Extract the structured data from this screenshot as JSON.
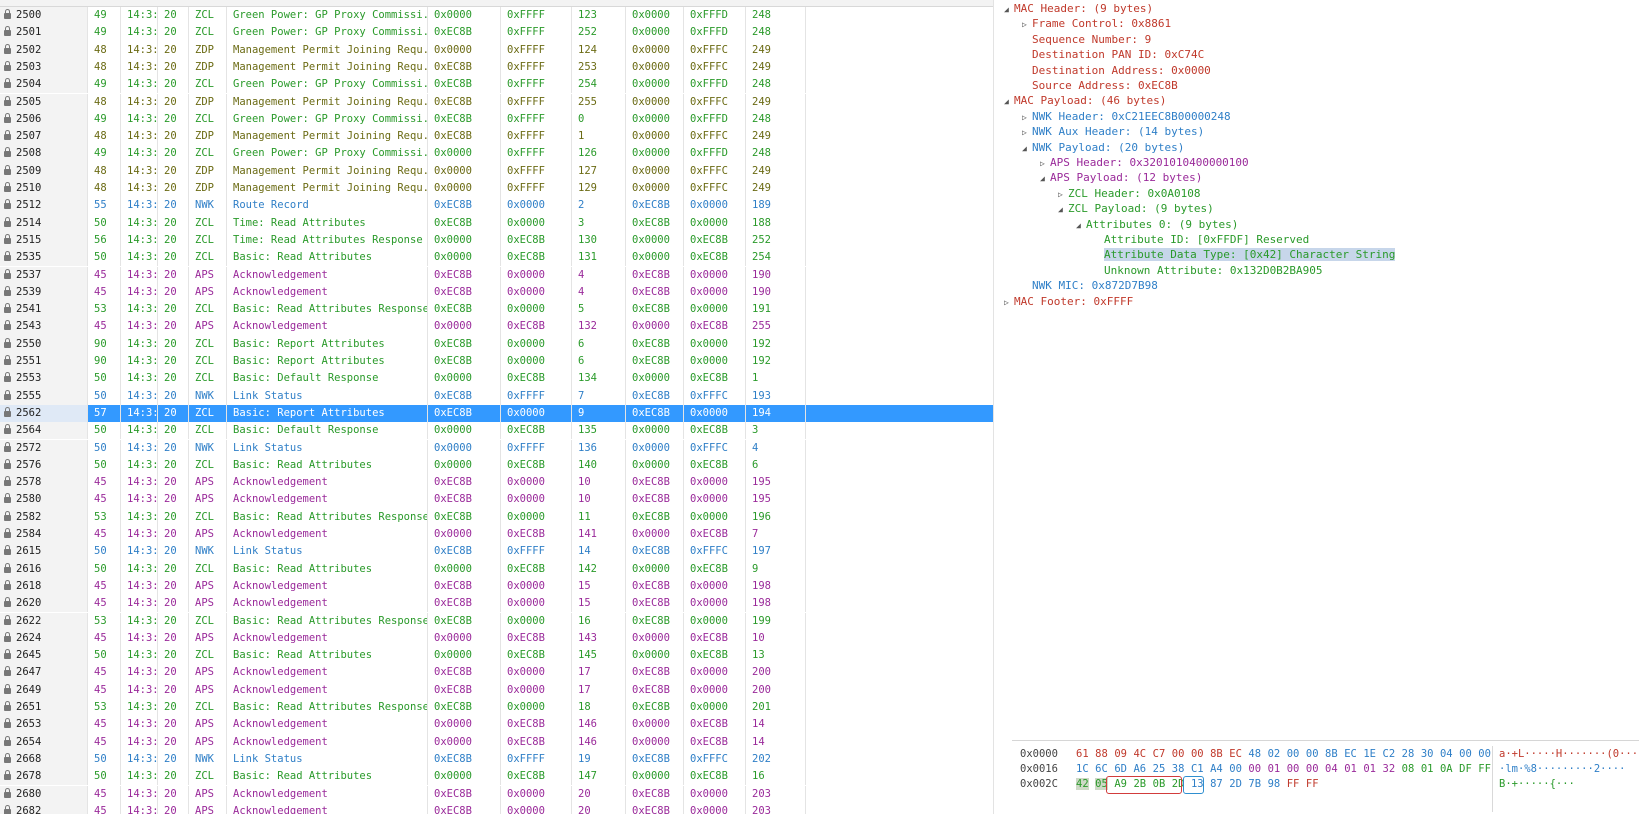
{
  "packet_list": {
    "rows": [
      [
        "2500",
        "49",
        "14:3:",
        "20",
        "ZCL",
        "Green Power: GP Proxy Commissi...",
        "0x0000",
        "0xFFFF",
        "123",
        "0x0000",
        "0xFFFD",
        "248"
      ],
      [
        "2501",
        "49",
        "14:3:",
        "20",
        "ZCL",
        "Green Power: GP Proxy Commissi...",
        "0xEC8B",
        "0xFFFF",
        "252",
        "0x0000",
        "0xFFFD",
        "248"
      ],
      [
        "2502",
        "48",
        "14:3:",
        "20",
        "ZDP",
        "Management Permit Joining Requ...",
        "0x0000",
        "0xFFFF",
        "124",
        "0x0000",
        "0xFFFC",
        "249"
      ],
      [
        "2503",
        "48",
        "14:3:",
        "20",
        "ZDP",
        "Management Permit Joining Requ...",
        "0xEC8B",
        "0xFFFF",
        "253",
        "0x0000",
        "0xFFFC",
        "249"
      ],
      [
        "2504",
        "49",
        "14:3:",
        "20",
        "ZCL",
        "Green Power: GP Proxy Commissi...",
        "0xEC8B",
        "0xFFFF",
        "254",
        "0x0000",
        "0xFFFD",
        "248"
      ],
      [
        "2505",
        "48",
        "14:3:",
        "20",
        "ZDP",
        "Management Permit Joining Requ...",
        "0xEC8B",
        "0xFFFF",
        "255",
        "0x0000",
        "0xFFFC",
        "249"
      ],
      [
        "2506",
        "49",
        "14:3:",
        "20",
        "ZCL",
        "Green Power: GP Proxy Commissi...",
        "0xEC8B",
        "0xFFFF",
        "0",
        "0x0000",
        "0xFFFD",
        "248"
      ],
      [
        "2507",
        "48",
        "14:3:",
        "20",
        "ZDP",
        "Management Permit Joining Requ...",
        "0xEC8B",
        "0xFFFF",
        "1",
        "0x0000",
        "0xFFFC",
        "249"
      ],
      [
        "2508",
        "49",
        "14:3:",
        "20",
        "ZCL",
        "Green Power: GP Proxy Commissi...",
        "0x0000",
        "0xFFFF",
        "126",
        "0x0000",
        "0xFFFD",
        "248"
      ],
      [
        "2509",
        "48",
        "14:3:",
        "20",
        "ZDP",
        "Management Permit Joining Requ...",
        "0x0000",
        "0xFFFF",
        "127",
        "0x0000",
        "0xFFFC",
        "249"
      ],
      [
        "2510",
        "48",
        "14:3:",
        "20",
        "ZDP",
        "Management Permit Joining Requ...",
        "0x0000",
        "0xFFFF",
        "129",
        "0x0000",
        "0xFFFC",
        "249"
      ],
      [
        "2512",
        "55",
        "14:3:",
        "20",
        "NWK",
        "Route Record",
        "0xEC8B",
        "0x0000",
        "2",
        "0xEC8B",
        "0x0000",
        "189"
      ],
      [
        "2514",
        "50",
        "14:3:",
        "20",
        "ZCL",
        "Time: Read Attributes",
        "0xEC8B",
        "0x0000",
        "3",
        "0xEC8B",
        "0x0000",
        "188"
      ],
      [
        "2515",
        "56",
        "14:3:",
        "20",
        "ZCL",
        "Time: Read Attributes Response",
        "0x0000",
        "0xEC8B",
        "130",
        "0x0000",
        "0xEC8B",
        "252"
      ],
      [
        "2535",
        "50",
        "14:3:",
        "20",
        "ZCL",
        "Basic: Read Attributes",
        "0x0000",
        "0xEC8B",
        "131",
        "0x0000",
        "0xEC8B",
        "254"
      ],
      [
        "2537",
        "45",
        "14:3:",
        "20",
        "APS",
        "Acknowledgement",
        "0xEC8B",
        "0x0000",
        "4",
        "0xEC8B",
        "0x0000",
        "190"
      ],
      [
        "2539",
        "45",
        "14:3:",
        "20",
        "APS",
        "Acknowledgement",
        "0xEC8B",
        "0x0000",
        "4",
        "0xEC8B",
        "0x0000",
        "190"
      ],
      [
        "2541",
        "53",
        "14:3:",
        "20",
        "ZCL",
        "Basic: Read Attributes Response",
        "0xEC8B",
        "0x0000",
        "5",
        "0xEC8B",
        "0x0000",
        "191"
      ],
      [
        "2543",
        "45",
        "14:3:",
        "20",
        "APS",
        "Acknowledgement",
        "0x0000",
        "0xEC8B",
        "132",
        "0x0000",
        "0xEC8B",
        "255"
      ],
      [
        "2550",
        "90",
        "14:3:",
        "20",
        "ZCL",
        "Basic: Report Attributes",
        "0xEC8B",
        "0x0000",
        "6",
        "0xEC8B",
        "0x0000",
        "192"
      ],
      [
        "2551",
        "90",
        "14:3:",
        "20",
        "ZCL",
        "Basic: Report Attributes",
        "0xEC8B",
        "0x0000",
        "6",
        "0xEC8B",
        "0x0000",
        "192"
      ],
      [
        "2553",
        "50",
        "14:3:",
        "20",
        "ZCL",
        "Basic: Default Response",
        "0x0000",
        "0xEC8B",
        "134",
        "0x0000",
        "0xEC8B",
        "1"
      ],
      [
        "2555",
        "50",
        "14:3:",
        "20",
        "NWK",
        "Link Status",
        "0xEC8B",
        "0xFFFF",
        "7",
        "0xEC8B",
        "0xFFFC",
        "193"
      ],
      [
        "2562",
        "57",
        "14:3:",
        "20",
        "ZCL",
        "Basic: Report Attributes",
        "0xEC8B",
        "0x0000",
        "9",
        "0xEC8B",
        "0x0000",
        "194"
      ],
      [
        "2564",
        "50",
        "14:3:",
        "20",
        "ZCL",
        "Basic: Default Response",
        "0x0000",
        "0xEC8B",
        "135",
        "0x0000",
        "0xEC8B",
        "3"
      ],
      [
        "2572",
        "50",
        "14:3:",
        "20",
        "NWK",
        "Link Status",
        "0x0000",
        "0xFFFF",
        "136",
        "0x0000",
        "0xFFFC",
        "4"
      ],
      [
        "2576",
        "50",
        "14:3:",
        "20",
        "ZCL",
        "Basic: Read Attributes",
        "0x0000",
        "0xEC8B",
        "140",
        "0x0000",
        "0xEC8B",
        "6"
      ],
      [
        "2578",
        "45",
        "14:3:",
        "20",
        "APS",
        "Acknowledgement",
        "0xEC8B",
        "0x0000",
        "10",
        "0xEC8B",
        "0x0000",
        "195"
      ],
      [
        "2580",
        "45",
        "14:3:",
        "20",
        "APS",
        "Acknowledgement",
        "0xEC8B",
        "0x0000",
        "10",
        "0xEC8B",
        "0x0000",
        "195"
      ],
      [
        "2582",
        "53",
        "14:3:",
        "20",
        "ZCL",
        "Basic: Read Attributes Response",
        "0xEC8B",
        "0x0000",
        "11",
        "0xEC8B",
        "0x0000",
        "196"
      ],
      [
        "2584",
        "45",
        "14:3:",
        "20",
        "APS",
        "Acknowledgement",
        "0x0000",
        "0xEC8B",
        "141",
        "0x0000",
        "0xEC8B",
        "7"
      ],
      [
        "2615",
        "50",
        "14:3:",
        "20",
        "NWK",
        "Link Status",
        "0xEC8B",
        "0xFFFF",
        "14",
        "0xEC8B",
        "0xFFFC",
        "197"
      ],
      [
        "2616",
        "50",
        "14:3:",
        "20",
        "ZCL",
        "Basic: Read Attributes",
        "0x0000",
        "0xEC8B",
        "142",
        "0x0000",
        "0xEC8B",
        "9"
      ],
      [
        "2618",
        "45",
        "14:3:",
        "20",
        "APS",
        "Acknowledgement",
        "0xEC8B",
        "0x0000",
        "15",
        "0xEC8B",
        "0x0000",
        "198"
      ],
      [
        "2620",
        "45",
        "14:3:",
        "20",
        "APS",
        "Acknowledgement",
        "0xEC8B",
        "0x0000",
        "15",
        "0xEC8B",
        "0x0000",
        "198"
      ],
      [
        "2622",
        "53",
        "14:3:",
        "20",
        "ZCL",
        "Basic: Read Attributes Response",
        "0xEC8B",
        "0x0000",
        "16",
        "0xEC8B",
        "0x0000",
        "199"
      ],
      [
        "2624",
        "45",
        "14:3:",
        "20",
        "APS",
        "Acknowledgement",
        "0x0000",
        "0xEC8B",
        "143",
        "0x0000",
        "0xEC8B",
        "10"
      ],
      [
        "2645",
        "50",
        "14:3:",
        "20",
        "ZCL",
        "Basic: Read Attributes",
        "0x0000",
        "0xEC8B",
        "145",
        "0x0000",
        "0xEC8B",
        "13"
      ],
      [
        "2647",
        "45",
        "14:3:",
        "20",
        "APS",
        "Acknowledgement",
        "0xEC8B",
        "0x0000",
        "17",
        "0xEC8B",
        "0x0000",
        "200"
      ],
      [
        "2649",
        "45",
        "14:3:",
        "20",
        "APS",
        "Acknowledgement",
        "0xEC8B",
        "0x0000",
        "17",
        "0xEC8B",
        "0x0000",
        "200"
      ],
      [
        "2651",
        "53",
        "14:3:",
        "20",
        "ZCL",
        "Basic: Read Attributes Response",
        "0xEC8B",
        "0x0000",
        "18",
        "0xEC8B",
        "0x0000",
        "201"
      ],
      [
        "2653",
        "45",
        "14:3:",
        "20",
        "APS",
        "Acknowledgement",
        "0x0000",
        "0xEC8B",
        "146",
        "0x0000",
        "0xEC8B",
        "14"
      ],
      [
        "2654",
        "45",
        "14:3:",
        "20",
        "APS",
        "Acknowledgement",
        "0x0000",
        "0xEC8B",
        "146",
        "0x0000",
        "0xEC8B",
        "14"
      ],
      [
        "2668",
        "50",
        "14:3:",
        "20",
        "NWK",
        "Link Status",
        "0xEC8B",
        "0xFFFF",
        "19",
        "0xEC8B",
        "0xFFFC",
        "202"
      ],
      [
        "2678",
        "50",
        "14:3:",
        "20",
        "ZCL",
        "Basic: Read Attributes",
        "0x0000",
        "0xEC8B",
        "147",
        "0x0000",
        "0xEC8B",
        "16"
      ],
      [
        "2680",
        "45",
        "14:3:",
        "20",
        "APS",
        "Acknowledgement",
        "0xEC8B",
        "0x0000",
        "20",
        "0xEC8B",
        "0x0000",
        "203"
      ],
      [
        "2682",
        "45",
        "14:3:",
        "20",
        "APS",
        "Acknowledgement",
        "0xEC8B",
        "0x0000",
        "20",
        "0xEC8B",
        "0x0000",
        "203"
      ]
    ],
    "selected_frame": "2562",
    "kind_colors": {
      "ZCL": "#2a9a2a",
      "ZDP": "#6b6b14",
      "NWK": "#2f7fc7",
      "APS": "#9a2a9a"
    }
  },
  "details": {
    "nodes": [
      {
        "text": "MAC Header: (9 bytes)",
        "tri": "open",
        "color": "red"
      },
      {
        "text": "Frame Control: 0x8861",
        "tri": "closed",
        "color": "red"
      },
      {
        "text": "Sequence Number: 9",
        "tri": "none",
        "color": "red"
      },
      {
        "text": "Destination PAN ID: 0xC74C",
        "tri": "none",
        "color": "red"
      },
      {
        "text": "Destination Address: 0x0000",
        "tri": "none",
        "color": "red"
      },
      {
        "text": "Source Address: 0xEC8B",
        "tri": "none",
        "color": "red"
      },
      {
        "text": "MAC Payload: (46 bytes)",
        "tri": "open",
        "color": "red"
      },
      {
        "text": "NWK Header: 0xC21EEC8B00000248",
        "tri": "closed",
        "color": "blue"
      },
      {
        "text": "NWK Aux Header: (14 bytes)",
        "tri": "closed",
        "color": "blue"
      },
      {
        "text": "NWK Payload: (20 bytes)",
        "tri": "open",
        "color": "blue"
      },
      {
        "text": "APS Header: 0x3201010400000100",
        "tri": "closed",
        "color": "purp"
      },
      {
        "text": "APS Payload: (12 bytes)",
        "tri": "open",
        "color": "purp"
      },
      {
        "text": "ZCL Header: 0x0A0108",
        "tri": "closed",
        "color": "green"
      },
      {
        "text": "ZCL Payload: (9 bytes)",
        "tri": "open",
        "color": "green"
      },
      {
        "text": "Attributes 0: (9 bytes)",
        "tri": "open",
        "color": "green"
      },
      {
        "text": "Attribute ID: [0xFFDF] Reserved",
        "tri": "none",
        "color": "green"
      },
      {
        "text": "Attribute Data Type: [0x42] Character String",
        "tri": "none",
        "color": "green",
        "selected": true
      },
      {
        "text": "Unknown Attribute: 0x132D0B2BA905",
        "tri": "none",
        "color": "green"
      },
      {
        "text": "NWK MIC: 0x872D7B98",
        "tri": "none",
        "color": "blue"
      },
      {
        "text": "MAC Footer: 0xFFFF",
        "tri": "closed",
        "color": "red"
      }
    ]
  },
  "hex": {
    "lines": [
      {
        "offset": "0x0000",
        "bytes": [
          [
            "61",
            "hr"
          ],
          [
            "88",
            "hr"
          ],
          [
            "09",
            "hr"
          ],
          [
            "4C",
            "hr"
          ],
          [
            "C7",
            "hr"
          ],
          [
            "00",
            "hr"
          ],
          [
            "00",
            "hr"
          ],
          [
            "8B",
            "hr"
          ],
          [
            "EC",
            "hr"
          ],
          [
            "48",
            "hb"
          ],
          [
            "02",
            "hb"
          ],
          [
            "00",
            "hb"
          ],
          [
            "00",
            "hb"
          ],
          [
            "8B",
            "hb"
          ],
          [
            "EC",
            "hb"
          ],
          [
            "1E",
            "hb"
          ],
          [
            "C2",
            "hb"
          ],
          [
            "28",
            "hb"
          ],
          [
            "30",
            "hb"
          ],
          [
            "04",
            "hb"
          ],
          [
            "00",
            "hb"
          ],
          [
            "00",
            "hb"
          ]
        ],
        "ascii": "a·+L·····H·······(0···"
      },
      {
        "offset": "0x0016",
        "bytes": [
          [
            "1C",
            "hb"
          ],
          [
            "6C",
            "hb"
          ],
          [
            "6D",
            "hb"
          ],
          [
            "A6",
            "hb"
          ],
          [
            "25",
            "hb"
          ],
          [
            "38",
            "hb"
          ],
          [
            "C1",
            "hb"
          ],
          [
            "A4",
            "hb"
          ],
          [
            "00",
            "hb"
          ],
          [
            "00",
            "hp"
          ],
          [
            "01",
            "hp"
          ],
          [
            "00",
            "hp"
          ],
          [
            "00",
            "hp"
          ],
          [
            "04",
            "hp"
          ],
          [
            "01",
            "hp"
          ],
          [
            "01",
            "hp"
          ],
          [
            "32",
            "hp"
          ],
          [
            "08",
            "hg"
          ],
          [
            "01",
            "hg"
          ],
          [
            "0A",
            "hg"
          ],
          [
            "DF",
            "hg"
          ],
          [
            "FF",
            "hg"
          ]
        ],
        "ascii": "·lm·%8·········2····"
      },
      {
        "offset": "0x002C",
        "bytes": [
          [
            "42",
            "hg"
          ],
          [
            "05",
            "hg"
          ],
          [
            "A9",
            "hg"
          ],
          [
            "2B",
            "hg"
          ],
          [
            "0B",
            "hg"
          ],
          [
            "2D",
            "hg"
          ],
          [
            "13",
            "hb"
          ],
          [
            "87",
            "hb"
          ],
          [
            "2D",
            "hb"
          ],
          [
            "7B",
            "hb"
          ],
          [
            "98",
            "hb"
          ],
          [
            "FF",
            "hr"
          ],
          [
            "FF",
            "hr"
          ]
        ],
        "ascii": "B·+·····{···"
      }
    ]
  }
}
